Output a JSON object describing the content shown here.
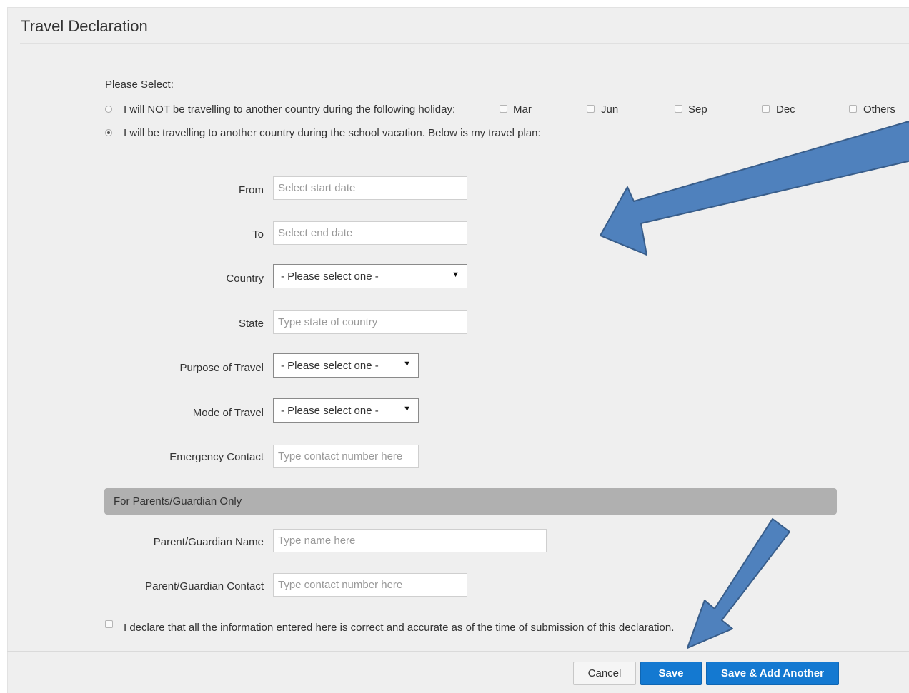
{
  "header": {
    "title": "Travel Declaration"
  },
  "selection": {
    "prompt": "Please Select:",
    "option_not_travelling": "I will NOT be travelling to another country during the following holiday:",
    "option_travelling": "I will be travelling to another country during the school vacation. Below is my travel plan:",
    "selected_option": "travelling",
    "holidays": [
      "Mar",
      "Jun",
      "Sep",
      "Dec",
      "Others"
    ]
  },
  "form": {
    "from_label": "From",
    "from_placeholder": "Select start date",
    "to_label": "To",
    "to_placeholder": "Select end date",
    "country_label": "Country",
    "country_value": "- Please select one -",
    "state_label": "State",
    "state_placeholder": "Type state of country",
    "purpose_label": "Purpose of Travel",
    "purpose_value": "- Please select one -",
    "mode_label": "Mode of Travel",
    "mode_value": "- Please select one -",
    "emergency_label": "Emergency Contact",
    "emergency_placeholder": "Type contact number here"
  },
  "parents": {
    "section_title": "For Parents/Guardian Only",
    "name_label": "Parent/Guardian Name",
    "name_placeholder": "Type name here",
    "contact_label": "Parent/Guardian Contact",
    "contact_placeholder": "Type contact number here"
  },
  "declaration": {
    "text": "I declare that all the information entered here is correct and accurate as of the time of submission of this declaration."
  },
  "footer": {
    "cancel_label": "Cancel",
    "save_label": "Save",
    "save_add_label": "Save & Add Another"
  },
  "colors": {
    "arrow_fill": "#4f81bd",
    "arrow_stroke": "#385d8a",
    "primary_button": "#1479d1",
    "section_bar": "#b0b0b0"
  }
}
